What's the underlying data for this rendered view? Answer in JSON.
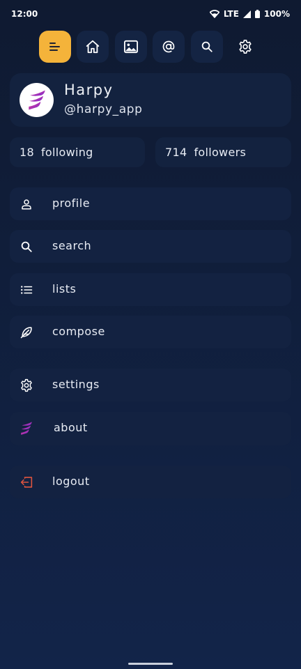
{
  "status_bar": {
    "time": "12:00",
    "network": "LTE",
    "battery": "100%"
  },
  "nav": {
    "buttons": [
      {
        "icon": "drawer-menu-icon",
        "active": true
      },
      {
        "icon": "home-icon",
        "active": false
      },
      {
        "icon": "image-icon",
        "active": false
      },
      {
        "icon": "at-sign-icon",
        "active": false
      },
      {
        "icon": "search-icon",
        "active": false
      },
      {
        "icon": "gear-icon",
        "active": false
      }
    ]
  },
  "profile": {
    "name": "Harpy",
    "handle": "@harpy_app"
  },
  "stats": {
    "following_count": "18",
    "following_label": "following",
    "followers_count": "714",
    "followers_label": "followers"
  },
  "menu": {
    "profile": "profile",
    "search": "search",
    "lists": "lists",
    "compose": "compose",
    "settings": "settings",
    "about": "about",
    "logout": "logout"
  },
  "colors": {
    "accent": "#f4b33a",
    "card": "#13223f",
    "logout": "#e0553f"
  }
}
